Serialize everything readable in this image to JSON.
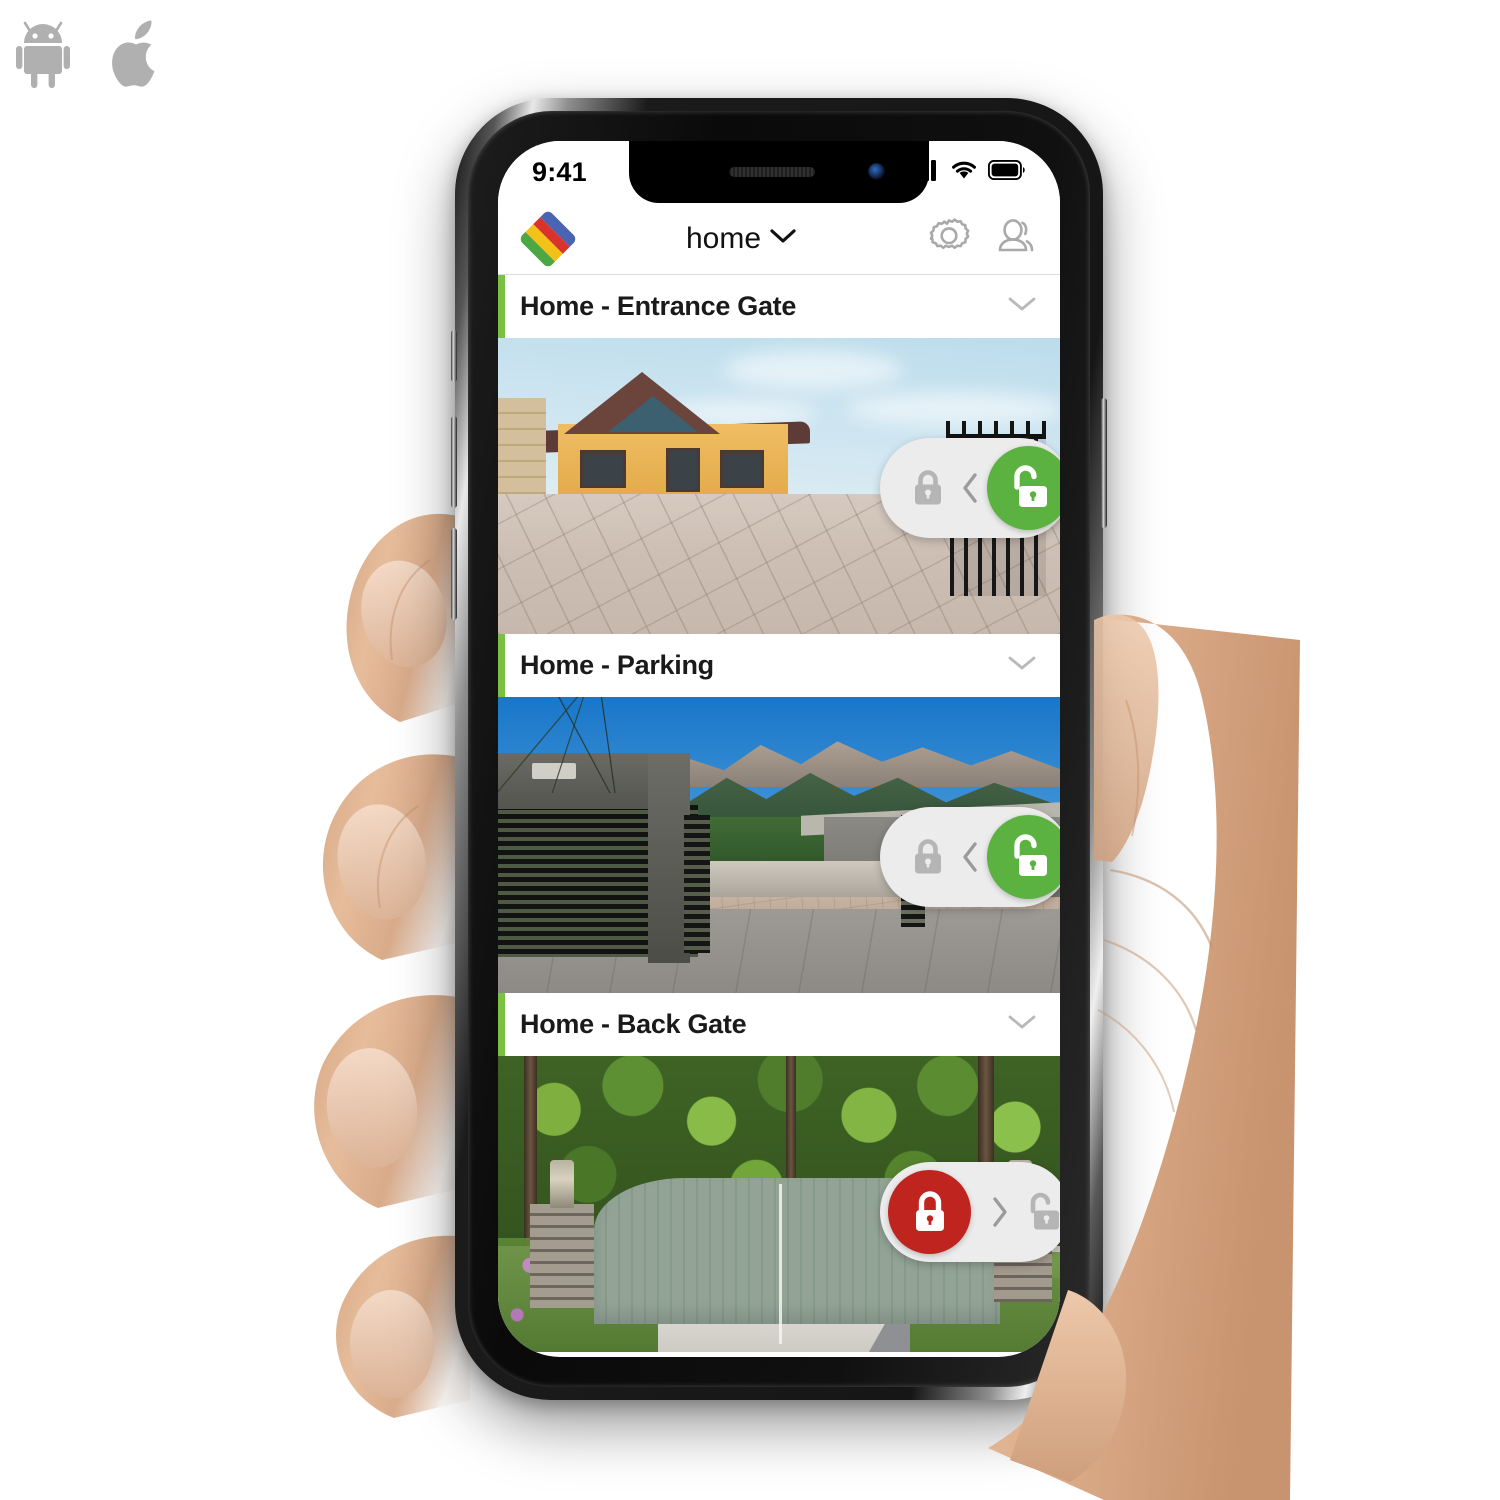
{
  "platform_badges": [
    {
      "name": "android-logo",
      "label": "Android"
    },
    {
      "name": "apple-logo",
      "label": "Apple iOS"
    }
  ],
  "device": {
    "type": "smartphone",
    "frame": "iphone-x-notch",
    "held_by": "right hand"
  },
  "status_bar": {
    "time": "9:41",
    "icons": [
      "cellular-signal-icon",
      "wifi-icon",
      "battery-icon"
    ],
    "signal_bars": 4,
    "battery_full": true
  },
  "app_header": {
    "logo_name": "app-logo",
    "logo_colors": [
      "#4a64b4",
      "#d9342b",
      "#f3c118",
      "#4ca644"
    ],
    "title": "home",
    "dropdown_icon": "chevron-down-icon",
    "actions": [
      {
        "name": "settings-button",
        "icon": "gear-icon"
      },
      {
        "name": "profile-button",
        "icon": "user-icon"
      }
    ]
  },
  "accent_color": "#7ac143",
  "lock_colors": {
    "unlocked": "#5cb241",
    "locked": "#c0241f",
    "inactive": "#b5b5b5",
    "track": "#ececec"
  },
  "cameras": [
    {
      "title": "Home - Entrance Gate",
      "collapse_icon": "chevron-down-icon",
      "scene": "yellow-house-driveway",
      "lock": {
        "state": "unlocked",
        "knob_icon": "unlock-icon",
        "static_icon": "lock-icon",
        "direction_icon": "chevron-left-icon"
      }
    },
    {
      "title": "Home - Parking",
      "collapse_icon": "chevron-down-icon",
      "scene": "slatted-gate-mountains",
      "lock": {
        "state": "unlocked",
        "knob_icon": "unlock-icon",
        "static_icon": "lock-icon",
        "direction_icon": "chevron-left-icon"
      }
    },
    {
      "title": "Home - Back Gate",
      "collapse_icon": "chevron-down-icon",
      "scene": "green-wooden-gate-forest",
      "lock": {
        "state": "locked",
        "knob_icon": "lock-icon",
        "static_icon": "unlock-icon",
        "direction_icon": "chevron-right-icon"
      }
    }
  ]
}
